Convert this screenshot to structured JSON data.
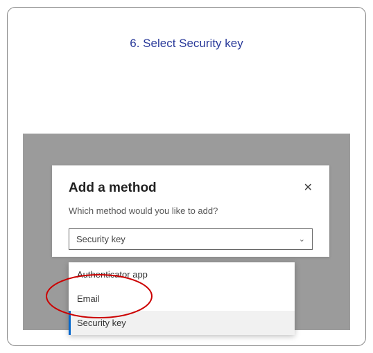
{
  "step": {
    "title": "6. Select Security key"
  },
  "dialog": {
    "title": "Add a method",
    "subtitle": "Which method would you like to add?",
    "select_value": "Security key",
    "options": {
      "auth_app": "Authenticator app",
      "email": "Email",
      "security_key": "Security key"
    }
  }
}
